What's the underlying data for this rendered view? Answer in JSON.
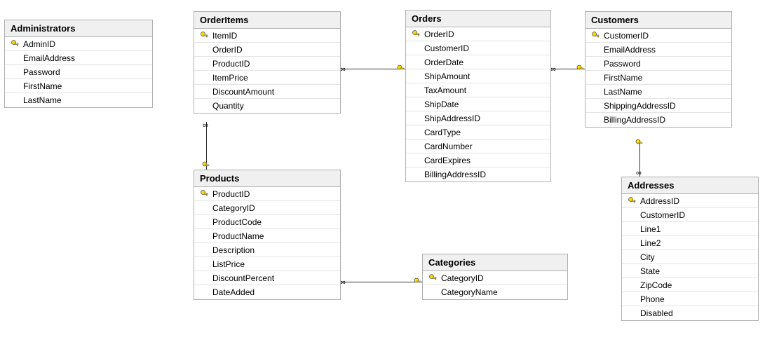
{
  "tables": {
    "administrators": {
      "title": "Administrators",
      "fields": [
        {
          "name": "AdminID",
          "pk": true
        },
        {
          "name": "EmailAddress",
          "pk": false
        },
        {
          "name": "Password",
          "pk": false
        },
        {
          "name": "FirstName",
          "pk": false
        },
        {
          "name": "LastName",
          "pk": false
        }
      ]
    },
    "orderitems": {
      "title": "OrderItems",
      "fields": [
        {
          "name": "ItemID",
          "pk": true
        },
        {
          "name": "OrderID",
          "pk": false
        },
        {
          "name": "ProductID",
          "pk": false
        },
        {
          "name": "ItemPrice",
          "pk": false
        },
        {
          "name": "DiscountAmount",
          "pk": false
        },
        {
          "name": "Quantity",
          "pk": false
        }
      ]
    },
    "orders": {
      "title": "Orders",
      "fields": [
        {
          "name": "OrderID",
          "pk": true
        },
        {
          "name": "CustomerID",
          "pk": false
        },
        {
          "name": "OrderDate",
          "pk": false
        },
        {
          "name": "ShipAmount",
          "pk": false
        },
        {
          "name": "TaxAmount",
          "pk": false
        },
        {
          "name": "ShipDate",
          "pk": false
        },
        {
          "name": "ShipAddressID",
          "pk": false
        },
        {
          "name": "CardType",
          "pk": false
        },
        {
          "name": "CardNumber",
          "pk": false
        },
        {
          "name": "CardExpires",
          "pk": false
        },
        {
          "name": "BillingAddressID",
          "pk": false
        }
      ]
    },
    "customers": {
      "title": "Customers",
      "fields": [
        {
          "name": "CustomerID",
          "pk": true
        },
        {
          "name": "EmailAddress",
          "pk": false
        },
        {
          "name": "Password",
          "pk": false
        },
        {
          "name": "FirstName",
          "pk": false
        },
        {
          "name": "LastName",
          "pk": false
        },
        {
          "name": "ShippingAddressID",
          "pk": false
        },
        {
          "name": "BillingAddressID",
          "pk": false
        }
      ]
    },
    "products": {
      "title": "Products",
      "fields": [
        {
          "name": "ProductID",
          "pk": true
        },
        {
          "name": "CategoryID",
          "pk": false
        },
        {
          "name": "ProductCode",
          "pk": false
        },
        {
          "name": "ProductName",
          "pk": false
        },
        {
          "name": "Description",
          "pk": false
        },
        {
          "name": "ListPrice",
          "pk": false
        },
        {
          "name": "DiscountPercent",
          "pk": false
        },
        {
          "name": "DateAdded",
          "pk": false
        }
      ]
    },
    "categories": {
      "title": "Categories",
      "fields": [
        {
          "name": "CategoryID",
          "pk": true
        },
        {
          "name": "CategoryName",
          "pk": false
        }
      ]
    },
    "addresses": {
      "title": "Addresses",
      "fields": [
        {
          "name": "AddressID",
          "pk": true
        },
        {
          "name": "CustomerID",
          "pk": false
        },
        {
          "name": "Line1",
          "pk": false
        },
        {
          "name": "Line2",
          "pk": false
        },
        {
          "name": "City",
          "pk": false
        },
        {
          "name": "State",
          "pk": false
        },
        {
          "name": "ZipCode",
          "pk": false
        },
        {
          "name": "Phone",
          "pk": false
        },
        {
          "name": "Disabled",
          "pk": false
        }
      ]
    }
  },
  "relationships": [
    {
      "from": "OrderItems",
      "from_side": "many",
      "to": "Orders",
      "to_side": "one"
    },
    {
      "from": "Orders",
      "from_side": "many",
      "to": "Customers",
      "to_side": "one"
    },
    {
      "from": "OrderItems",
      "from_side": "many",
      "to": "Products",
      "to_side": "one"
    },
    {
      "from": "Products",
      "from_side": "many",
      "to": "Categories",
      "to_side": "one"
    },
    {
      "from": "Addresses",
      "from_side": "many",
      "to": "Customers",
      "to_side": "one"
    }
  ]
}
